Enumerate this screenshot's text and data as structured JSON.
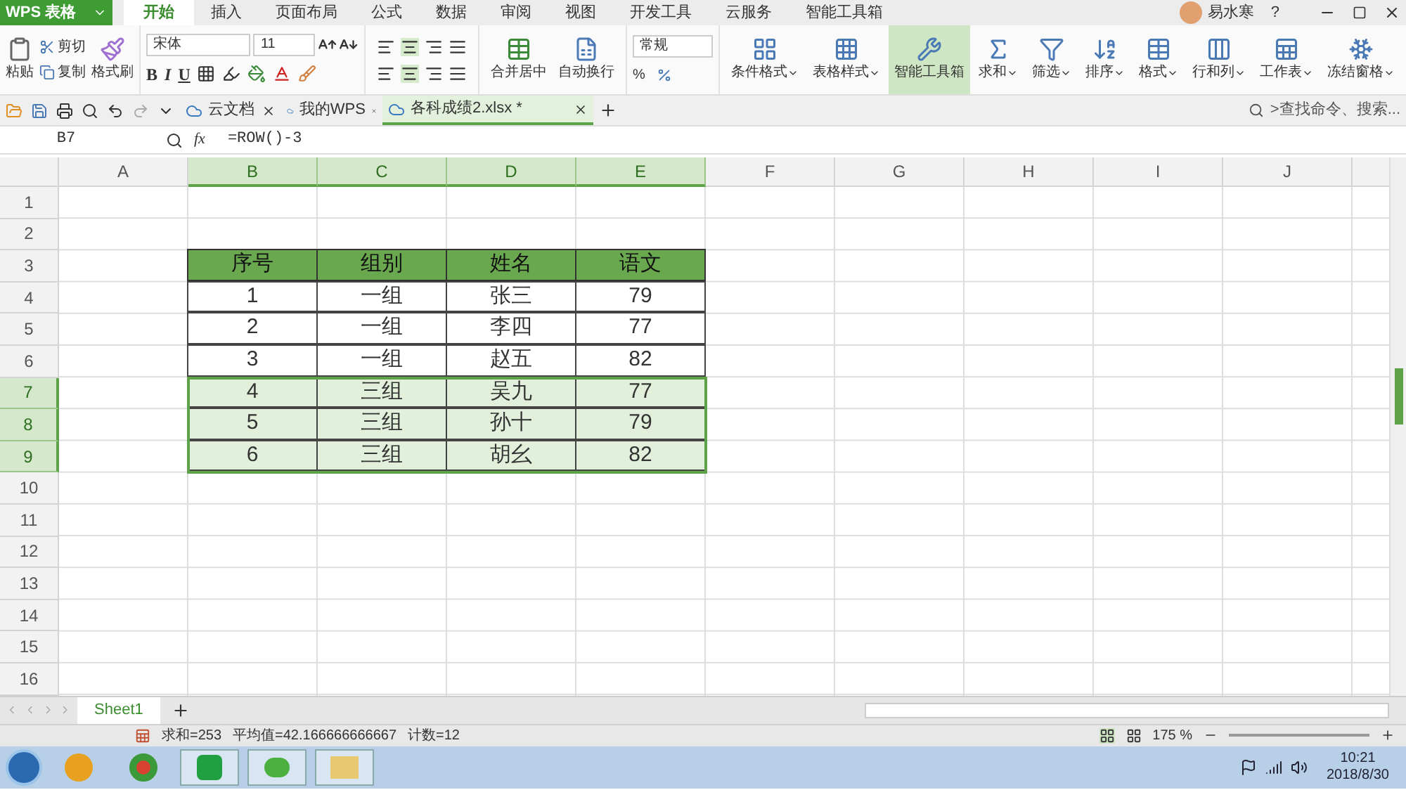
{
  "app": {
    "logo": "WPS 表格",
    "user": "易水寒",
    "help": "?",
    "menu_tabs": [
      {
        "label": "开始",
        "selected": true
      },
      {
        "label": "插入",
        "selected": false
      },
      {
        "label": "页面布局",
        "selected": false
      },
      {
        "label": "公式",
        "selected": false
      },
      {
        "label": "数据",
        "selected": false
      },
      {
        "label": "审阅",
        "selected": false
      },
      {
        "label": "视图",
        "selected": false
      },
      {
        "label": "开发工具",
        "selected": false
      },
      {
        "label": "云服务",
        "selected": false
      },
      {
        "label": "智能工具箱",
        "selected": false
      }
    ]
  },
  "ribbon": {
    "clipboard": {
      "paste": "粘贴",
      "cut": "剪切",
      "copy": "复制",
      "format_painter": "格式刷"
    },
    "font": {
      "name": "宋体",
      "size": "11",
      "styles": [
        "B",
        "I",
        "U"
      ]
    },
    "alignment": {
      "merge": "合并居中",
      "wrap": "自动换行"
    },
    "number": {
      "format": "常规",
      "percent": "%"
    },
    "tools": [
      {
        "label": "条件格式",
        "selected": false,
        "menu": true
      },
      {
        "label": "表格样式",
        "selected": false,
        "menu": true
      },
      {
        "label": "智能工具箱",
        "selected": true,
        "menu": false
      },
      {
        "label": "求和",
        "selected": false,
        "menu": true
      },
      {
        "label": "筛选",
        "selected": false,
        "menu": true
      },
      {
        "label": "排序",
        "selected": false,
        "menu": true
      },
      {
        "label": "格式",
        "selected": false,
        "menu": true
      },
      {
        "label": "行和列",
        "selected": false,
        "menu": true
      },
      {
        "label": "工作表",
        "selected": false,
        "menu": true
      },
      {
        "label": "冻结窗格",
        "selected": false,
        "menu": true
      }
    ]
  },
  "doc_tabs": [
    {
      "label": "云文档",
      "selected": false
    },
    {
      "label": "我的WPS",
      "selected": false
    },
    {
      "label": "各科成绩2.xlsx *",
      "selected": true
    }
  ],
  "search": {
    "placeholder": ">查找命令、搜索..."
  },
  "formula_bar": {
    "cell": "B7",
    "fx": "fx",
    "formula": "=ROW()-3"
  },
  "columns": [
    {
      "label": "A",
      "selected": false
    },
    {
      "label": "B",
      "selected": true
    },
    {
      "label": "C",
      "selected": true
    },
    {
      "label": "D",
      "selected": true
    },
    {
      "label": "E",
      "selected": true
    },
    {
      "label": "F",
      "selected": false
    },
    {
      "label": "G",
      "selected": false
    },
    {
      "label": "H",
      "selected": false
    },
    {
      "label": "I",
      "selected": false
    },
    {
      "label": "J",
      "selected": false
    }
  ],
  "rows": [
    {
      "label": "1",
      "selected": false
    },
    {
      "label": "2",
      "selected": false
    },
    {
      "label": "3",
      "selected": false
    },
    {
      "label": "4",
      "selected": false
    },
    {
      "label": "5",
      "selected": false
    },
    {
      "label": "6",
      "selected": false
    },
    {
      "label": "7",
      "selected": true
    },
    {
      "label": "8",
      "selected": true
    },
    {
      "label": "9",
      "selected": true
    },
    {
      "label": "10",
      "selected": false
    },
    {
      "label": "11",
      "selected": false
    },
    {
      "label": "12",
      "selected": false
    },
    {
      "label": "13",
      "selected": false
    },
    {
      "label": "14",
      "selected": false
    },
    {
      "label": "15",
      "selected": false
    },
    {
      "label": "16",
      "selected": false
    }
  ],
  "table": {
    "header": [
      "序号",
      "组别",
      "姓名",
      "语文"
    ],
    "rows": [
      {
        "cells": [
          "1",
          "一组",
          "张三",
          "79"
        ],
        "selected": false
      },
      {
        "cells": [
          "2",
          "一组",
          "李四",
          "77"
        ],
        "selected": false
      },
      {
        "cells": [
          "3",
          "一组",
          "赵五",
          "82"
        ],
        "selected": false
      },
      {
        "cells": [
          "4",
          "三组",
          "吴九",
          "77"
        ],
        "selected": true
      },
      {
        "cells": [
          "5",
          "三组",
          "孙十",
          "79"
        ],
        "selected": true
      },
      {
        "cells": [
          "6",
          "三组",
          "胡幺",
          "82"
        ],
        "selected": true
      }
    ]
  },
  "sheet_tabs": [
    {
      "label": "Sheet1",
      "selected": true
    }
  ],
  "status_bar": {
    "stats": [
      "求和=253",
      "平均值=42.166666666667",
      "计数=12"
    ],
    "zoom": "175 %"
  },
  "taskbar": {
    "time": "10:21",
    "date": "2018/8/30"
  }
}
